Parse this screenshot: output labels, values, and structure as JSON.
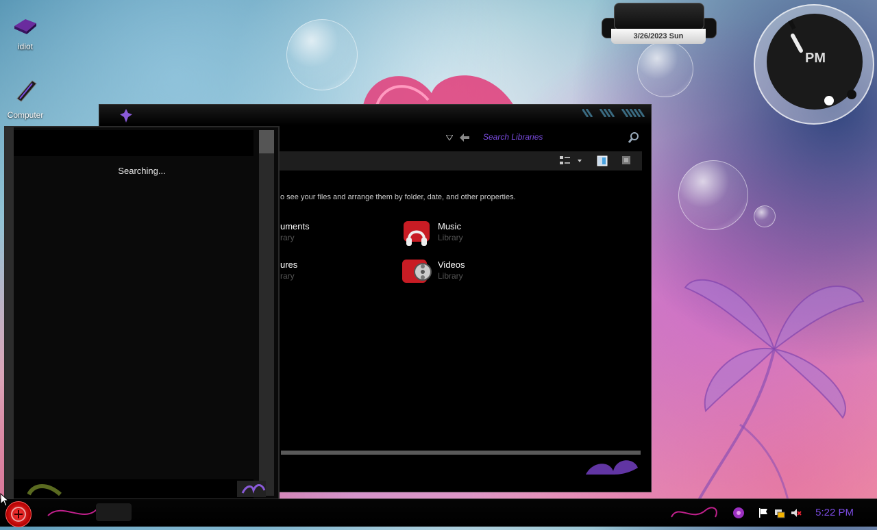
{
  "desktop": {
    "icons": [
      {
        "label": "idiot",
        "icon": "user-folder-icon"
      },
      {
        "label": "Computer",
        "icon": "computer-icon"
      }
    ]
  },
  "gadgets": {
    "date_text": "3/26/2023 Sun",
    "analog_label": "PM"
  },
  "explorer": {
    "search_placeholder": "Search Libraries",
    "info_text": "o see your files and arrange them by folder, date, and other properties.",
    "libraries": [
      {
        "name": "uments",
        "type": "rary",
        "icon": "documents-icon"
      },
      {
        "name": "Music",
        "type": "Library",
        "icon": "music-library-icon"
      },
      {
        "name": "ures",
        "type": "rary",
        "icon": "pictures-icon"
      },
      {
        "name": "Videos",
        "type": "Library",
        "icon": "videos-library-icon"
      }
    ]
  },
  "search_panel": {
    "status": "Searching..."
  },
  "taskbar": {
    "time": "5:22 PM",
    "tray_icons": [
      "action-center-flag-icon",
      "network-icon",
      "volume-muted-icon"
    ]
  },
  "colors": {
    "accent": "#7a4be0",
    "start": "#e00000"
  }
}
